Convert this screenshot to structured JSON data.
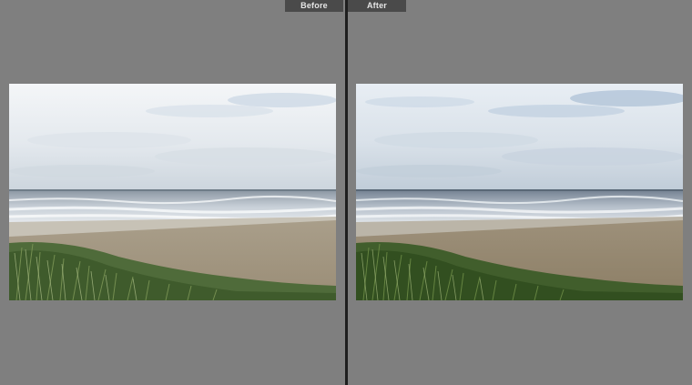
{
  "before_pane": {
    "label": "Before",
    "image": "beach-scene-original"
  },
  "after_pane": {
    "label": "After",
    "image": "beach-scene-edited"
  },
  "colors": {
    "background": "#7f7f7f",
    "divider": "#1e1e1e",
    "tab_background": "#4a4a4a",
    "tab_text": "#e6e6e6"
  }
}
